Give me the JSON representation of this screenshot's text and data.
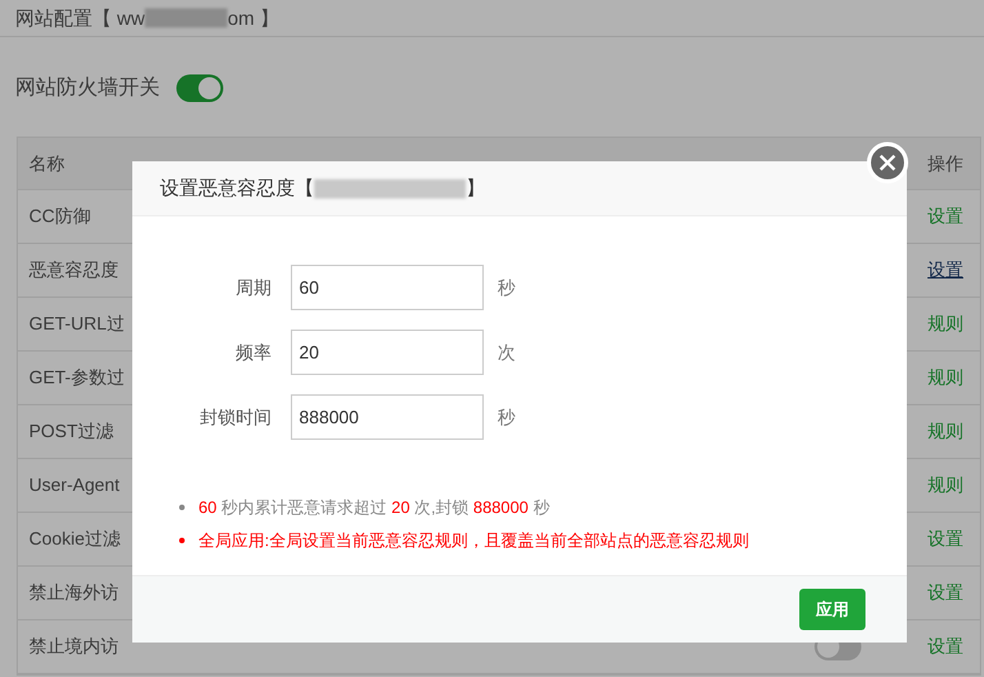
{
  "page": {
    "title_start": "网站配置【 ww",
    "title_end": "om 】"
  },
  "firewall": {
    "label": "网站防火墙开关",
    "on": true
  },
  "table": {
    "columns": [
      "名称",
      "操作"
    ],
    "rows": [
      {
        "name": "CC防御",
        "action": "设置",
        "hovered": false
      },
      {
        "name": "恶意容忍度",
        "action": "设置",
        "hovered": true
      },
      {
        "name": "GET-URL过",
        "action": "规则",
        "hovered": false
      },
      {
        "name": "GET-参数过",
        "action": "规则",
        "hovered": false
      },
      {
        "name": "POST过滤",
        "action": "规则",
        "hovered": false
      },
      {
        "name": "User-Agent",
        "action": "规则",
        "hovered": false
      },
      {
        "name": "Cookie过滤",
        "action": "设置",
        "hovered": false
      },
      {
        "name": "禁止海外访",
        "action": "设置",
        "hovered": false
      },
      {
        "name": "禁止境内访",
        "action": "设置",
        "hovered": false,
        "status_on": false
      }
    ]
  },
  "dialog": {
    "title_start": "设置恶意容忍度【",
    "title_end": "】",
    "fields": [
      {
        "label": "周期",
        "value": "60",
        "unit": "秒"
      },
      {
        "label": "频率",
        "value": "20",
        "unit": "次"
      },
      {
        "label": "封锁时间",
        "value": "888000",
        "unit": "秒"
      }
    ],
    "notes": [
      {
        "kind": "info",
        "parts": [
          {
            "text": "60",
            "highlight": true
          },
          {
            "text": " 秒内累计恶意请求超过 ",
            "highlight": false
          },
          {
            "text": "20",
            "highlight": true
          },
          {
            "text": " 次,封锁 ",
            "highlight": false
          },
          {
            "text": "888000",
            "highlight": true
          },
          {
            "text": " 秒",
            "highlight": false
          }
        ]
      },
      {
        "kind": "warning",
        "text": "全局应用:全局设置当前恶意容忍规则，且覆盖当前全部站点的恶意容忍规则"
      }
    ],
    "apply_button": "应用"
  }
}
